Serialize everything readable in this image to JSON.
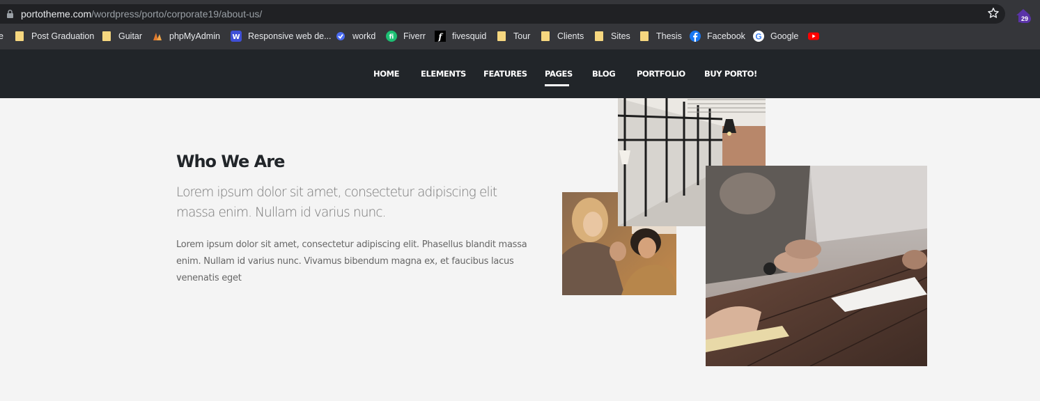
{
  "browser": {
    "url_host": "portotheme.com",
    "url_path": "/wordpress/porto/corporate19/about-us/",
    "extension_badge": "29",
    "bookmark_cut_label": "e",
    "bookmarks": [
      {
        "label": "Post Graduation",
        "icon": "folder-icon"
      },
      {
        "label": "Guitar",
        "icon": "folder-icon"
      },
      {
        "label": "phpMyAdmin",
        "icon": "phpmyadmin-icon"
      },
      {
        "label": "Responsive web de...",
        "icon": "w-icon"
      },
      {
        "label": "workd",
        "icon": "workd-icon"
      },
      {
        "label": "Fiverr",
        "icon": "fiverr-icon"
      },
      {
        "label": "fivesquid",
        "icon": "fivesquid-icon"
      },
      {
        "label": "Tour",
        "icon": "folder-icon"
      },
      {
        "label": "Clients",
        "icon": "folder-icon"
      },
      {
        "label": "Sites",
        "icon": "folder-icon"
      },
      {
        "label": "Thesis",
        "icon": "folder-icon"
      },
      {
        "label": "Facebook",
        "icon": "facebook-icon"
      },
      {
        "label": "Google",
        "icon": "google-icon"
      },
      {
        "label": "",
        "icon": "youtube-icon"
      }
    ]
  },
  "nav": {
    "items": [
      "HOME",
      "ELEMENTS",
      "FEATURES",
      "PAGES",
      "BLOG",
      "PORTFOLIO",
      "BUY PORTO!"
    ],
    "active": "PAGES"
  },
  "about": {
    "heading_light": "Who",
    "heading_bold": "We Are",
    "lead": "Lorem ipsum dolor sit amet, consectetur adipiscing elit massa enim. Nullam id varius nunc.",
    "body": "Lorem ipsum dolor sit amet, consectetur adipiscing elit. Phasellus blandit massa enim. Nullam id varius nunc. Vivamus bibendum magna ex, et faucibus lacus venenatis eget"
  },
  "colors": {
    "chrome_bg": "#35363a",
    "nav_bg": "#212529",
    "page_bg": "#f4f4f4",
    "heading": "#212529",
    "muted_text": "#777777"
  }
}
